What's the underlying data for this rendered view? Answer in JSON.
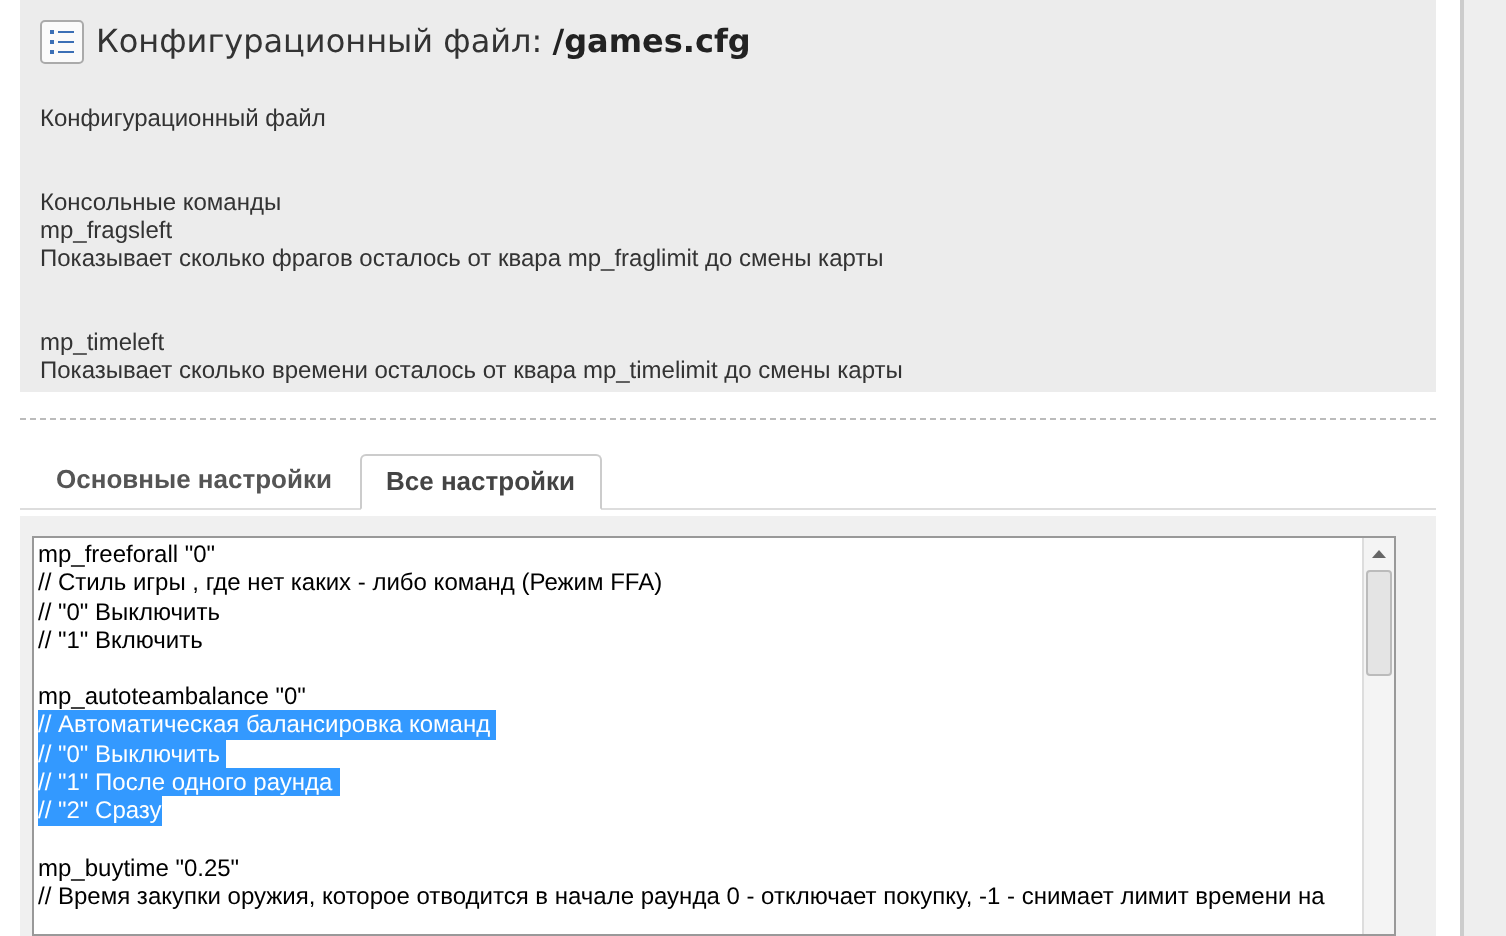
{
  "header": {
    "title": "Конфигурационный файл:",
    "filename": "/games.cfg"
  },
  "description": [
    {
      "lines": [
        "Конфигурационный файл"
      ]
    },
    {
      "lines": [
        "Консольные команды",
        "mp_fragsleft",
        "Показывает сколько фрагов осталось от квара mp_fraglimit до смены карты"
      ]
    },
    {
      "lines": [
        "mp_timeleft",
        "Показывает сколько времени осталось от квара mp_timelimit до смены карты"
      ]
    }
  ],
  "tabs": [
    {
      "label": "Основные настройки",
      "selected": false
    },
    {
      "label": "Все настройки",
      "selected": true
    }
  ],
  "editor": {
    "blocks": [
      {
        "lines": [
          {
            "text": "mp_freeforall \"0\"",
            "selected": false
          },
          {
            "text": "// Стиль игры , где нет каких - либо команд (Режим FFA)",
            "selected": false
          },
          {
            "text": "// \"0\" Выключить",
            "selected": false
          },
          {
            "text": "// \"1\" Включить",
            "selected": false
          }
        ]
      },
      {
        "lines": [
          {
            "text": "mp_autoteambalance \"0\"",
            "selected": false
          },
          {
            "text": "// Автоматическая балансировка команд ",
            "selected": true
          },
          {
            "text": "// \"0\" Выключить ",
            "selected": true
          },
          {
            "text": "// \"1\" После одного раунда ",
            "selected": true
          },
          {
            "text": "// \"2\" Сразу",
            "selected": true
          }
        ]
      },
      {
        "lines": [
          {
            "text": "mp_buytime \"0.25\"",
            "selected": false
          },
          {
            "text": "// Время закупки оружия, которое отводится в начале раунда 0 - отключает покупку, -1 - снимает лимит времени на",
            "selected": false
          }
        ]
      }
    ]
  }
}
